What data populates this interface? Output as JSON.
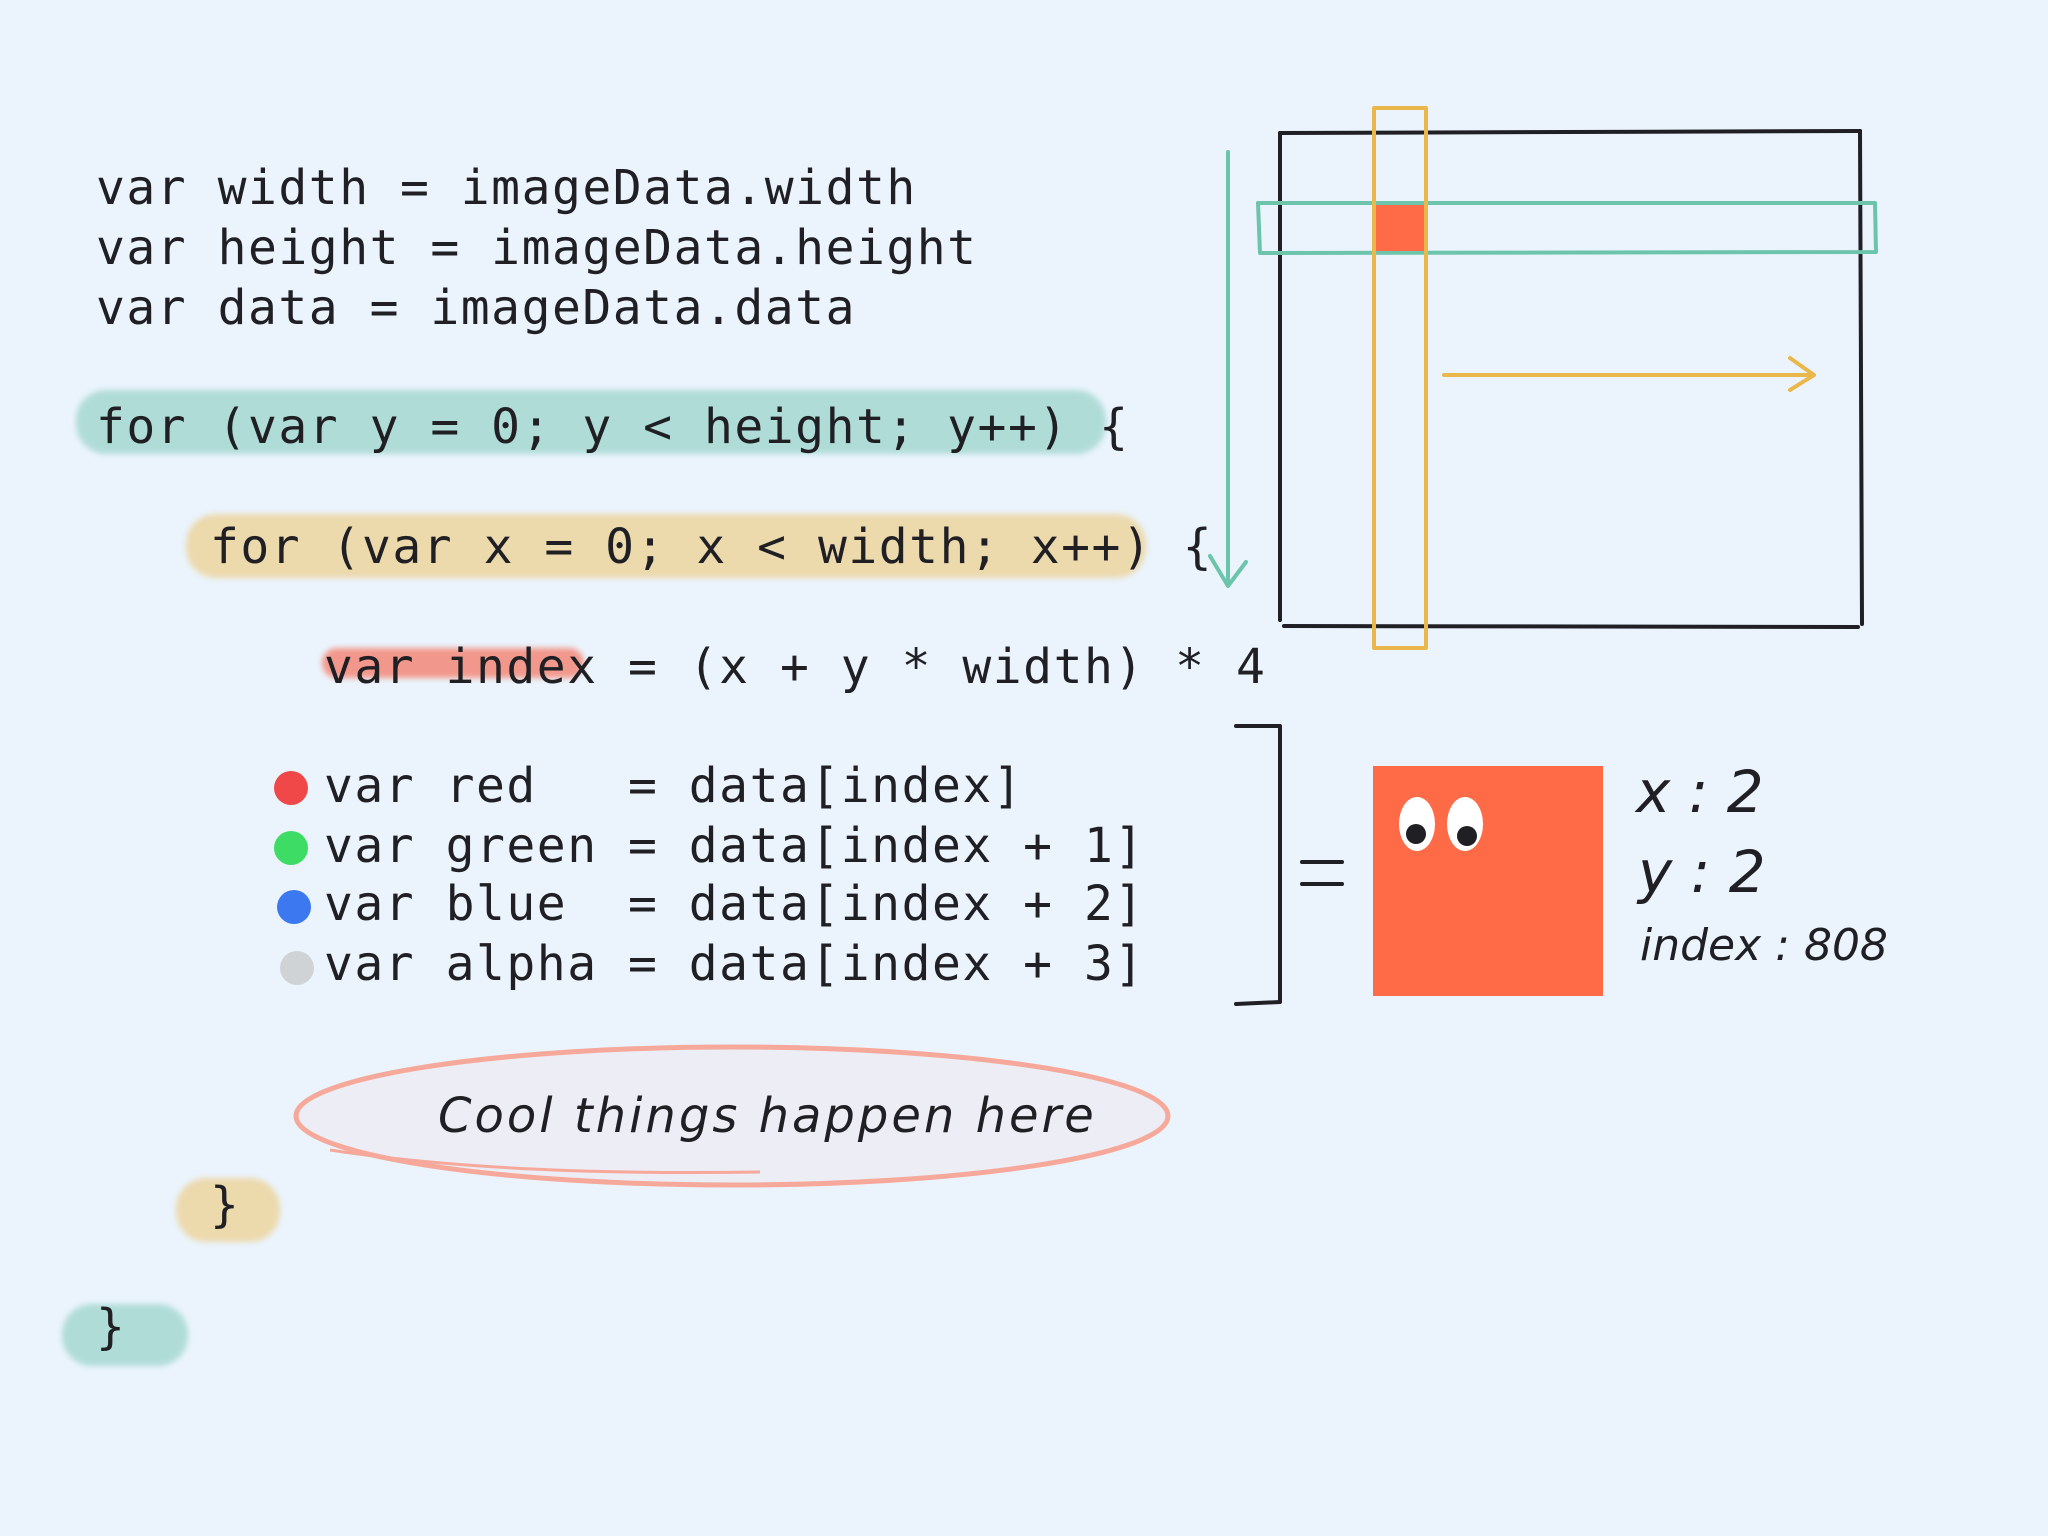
{
  "code": {
    "line_width": "var width = imageData.width",
    "line_height": "var height = imageData.height",
    "line_data": "var data = imageData.data",
    "for_y": "for (var y = 0; y < height; y++) {",
    "for_x": "for (var x = 0; x < width; x++) {",
    "index_line": "var index = (x + y * width) * 4",
    "red_line": "var red   = data[index]",
    "green_line": "var green = data[index + 1]",
    "blue_line": "var blue  = data[index + 2]",
    "alpha_line": "var alpha = data[index + 3]",
    "close_inner": "}",
    "close_outer": "}"
  },
  "channel_colors": {
    "red": "#f04848",
    "green": "#3ddc64",
    "blue": "#3c78f0",
    "alpha": "#cfd3d6"
  },
  "callout": {
    "text": "Cool things happen here"
  },
  "pixel": {
    "equals": "=",
    "x_label": "x : 2",
    "y_label": "y : 2",
    "index_label": "index : 808",
    "color": "#ff6b47"
  },
  "colors": {
    "background": "#ebf4fd",
    "teal": "#6cc4aa",
    "gold": "#eab84a",
    "ink": "#1f1f24"
  }
}
